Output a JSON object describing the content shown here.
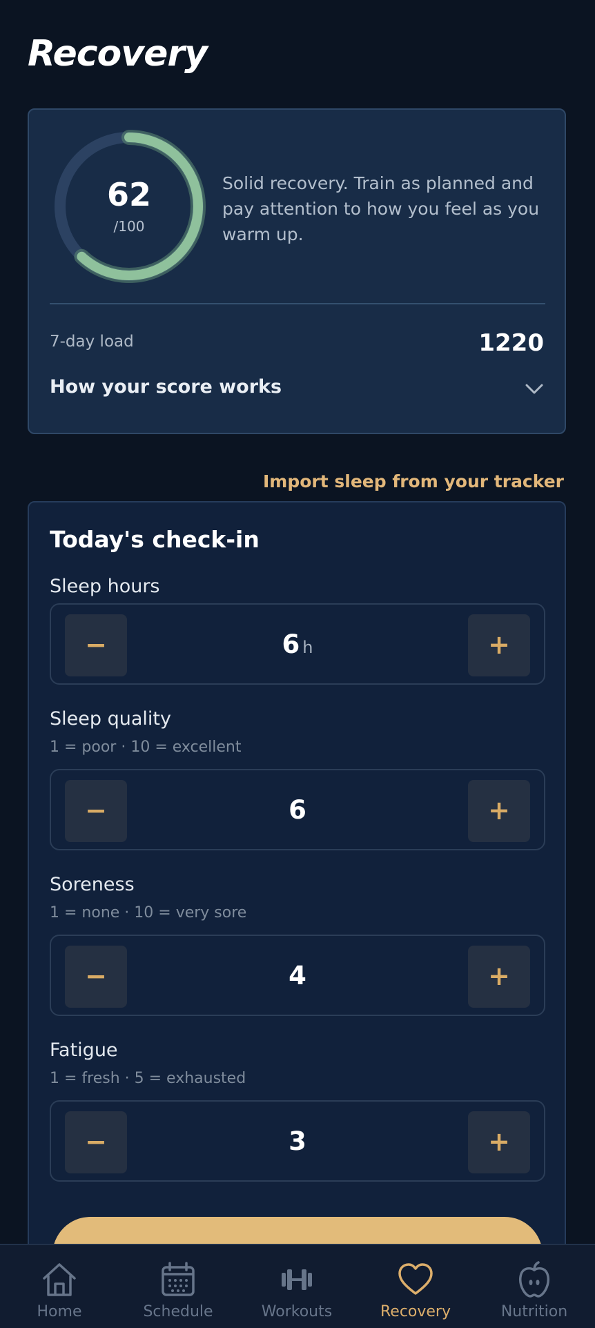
{
  "header": {
    "title": "Recovery"
  },
  "score_card": {
    "score": "62",
    "score_max": "/100",
    "score_fraction": 0.62,
    "description": "Solid recovery. Train as planned and pay attention to how you feel as you warm up.",
    "load_label": "7-day load",
    "load_value": "1220",
    "explain_label": "How your score works",
    "explain_icon": "chevron-down-icon",
    "ring_color": "#8fc19c",
    "ring_track_color": "#2c4262"
  },
  "import_link": "Import sleep from your tracker",
  "checkin": {
    "title": "Today's check-in",
    "fields": [
      {
        "label": "Sleep hours",
        "hint": "",
        "value": "6",
        "unit": "h"
      },
      {
        "label": "Sleep quality",
        "hint": "1 = poor · 10 = excellent",
        "value": "6",
        "unit": ""
      },
      {
        "label": "Soreness",
        "hint": "1 = none · 10 = very sore",
        "value": "4",
        "unit": ""
      },
      {
        "label": "Fatigue",
        "hint": "1 = fresh · 5 = exhausted",
        "value": "3",
        "unit": ""
      }
    ],
    "minus_label": "−",
    "plus_label": "+"
  },
  "nav": {
    "items": [
      {
        "label": "Home",
        "icon": "home-icon"
      },
      {
        "label": "Schedule",
        "icon": "calendar-icon"
      },
      {
        "label": "Workouts",
        "icon": "dumbbell-icon"
      },
      {
        "label": "Recovery",
        "icon": "heart-icon",
        "active": true
      },
      {
        "label": "Nutrition",
        "icon": "apple-icon"
      }
    ]
  },
  "colors": {
    "accent": "#e2b77a",
    "background": "#0b1422",
    "card": "#182c47"
  }
}
